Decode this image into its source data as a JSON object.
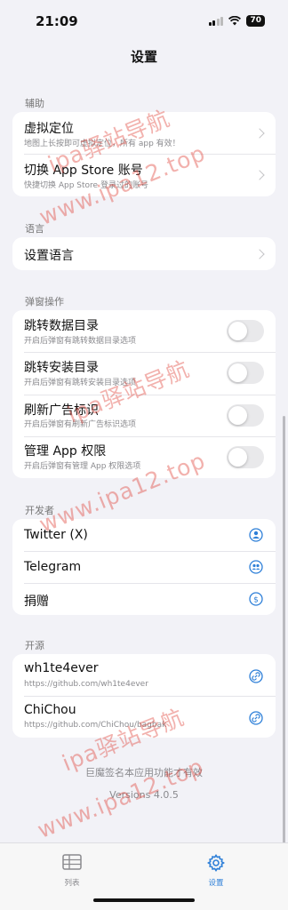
{
  "status_bar": {
    "time": "21:09",
    "battery": "70"
  },
  "title": "设置",
  "sections": {
    "assist": {
      "header": "辅助",
      "items": [
        {
          "title": "虚拟定位",
          "subtitle": "地图上长按即可虚拟定位，所有 app 有效！"
        },
        {
          "title": "切换 App Store 账号",
          "subtitle": "快捷切换 App Store 登录过的账号"
        }
      ]
    },
    "language": {
      "header": "语言",
      "items": [
        {
          "title": "设置语言"
        }
      ]
    },
    "popup": {
      "header": "弹窗操作",
      "items": [
        {
          "title": "跳转数据目录",
          "subtitle": "开启后弹窗有跳转数据目录选项",
          "on": false
        },
        {
          "title": "跳转安装目录",
          "subtitle": "开启后弹窗有跳转安装目录选项",
          "on": false
        },
        {
          "title": "刷新广告标识",
          "subtitle": "开启后弹窗有刷新广告标识选项",
          "on": false
        },
        {
          "title": "管理 App 权限",
          "subtitle": "开启后弹窗有管理 App 权限选项",
          "on": false
        }
      ]
    },
    "developer": {
      "header": "开发者",
      "items": [
        {
          "title": "Twitter (X)",
          "icon": "person-circle-icon"
        },
        {
          "title": "Telegram",
          "icon": "group-circle-icon"
        },
        {
          "title": "捐赠",
          "icon": "dollar-circle-icon"
        }
      ]
    },
    "open_source": {
      "header": "开源",
      "items": [
        {
          "title": "wh1te4ever",
          "subtitle": "https://github.com/wh1te4ever",
          "icon": "link-circle-icon"
        },
        {
          "title": "ChiChou",
          "subtitle": "https://github.com/ChiChou/bagbak",
          "icon": "link-circle-icon"
        }
      ]
    }
  },
  "footer": {
    "note": "巨魔签名本应用功能才有效",
    "version": "Versions 4.0.5"
  },
  "tab_bar": {
    "tabs": [
      {
        "label": "列表",
        "icon": "list-grid-icon",
        "selected": false
      },
      {
        "label": "设置",
        "icon": "gear-icon",
        "selected": true
      }
    ]
  },
  "watermark": {
    "line1": "ipa驿站导航",
    "line2": "www.ipa12.top"
  },
  "colors": {
    "accent": "#2d7fd8",
    "background": "#f2f2f7",
    "watermark": "#e1463c"
  }
}
